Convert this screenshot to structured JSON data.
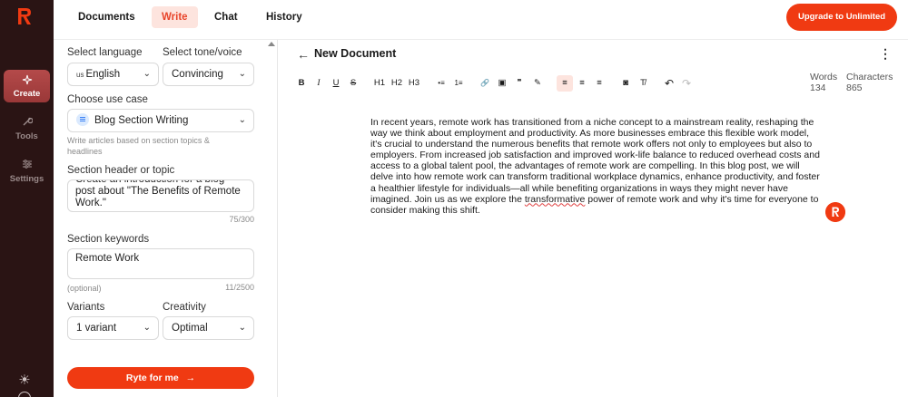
{
  "rail": {
    "items": [
      {
        "label": "Create",
        "icon": "sparkle-icon"
      },
      {
        "label": "Tools",
        "icon": "wrench-icon"
      },
      {
        "label": "Settings",
        "icon": "sliders-icon"
      }
    ],
    "theme_icon": "sun-icon",
    "bottom_icon": "help-icon"
  },
  "topnav": {
    "tabs": [
      "Documents",
      "Write",
      "Chat",
      "History"
    ],
    "active_tab": "Write",
    "upgrade_label": "Upgrade to Unlimited"
  },
  "form": {
    "language_label": "Select language",
    "language_flag": "us",
    "language_value": "English",
    "tone_label": "Select tone/voice",
    "tone_value": "Convincing",
    "usecase_label": "Choose use case",
    "usecase_value": "Blog Section Writing",
    "usecase_hint": "Write articles based on section topics & headlines",
    "topic_label": "Section header or topic",
    "topic_value": "Create an introduction for a blog post about \"The Benefits of Remote Work.\"",
    "topic_counter": "75/300",
    "keywords_label": "Section keywords",
    "keywords_value": "Remote Work",
    "keywords_optional": "(optional)",
    "keywords_counter": "11/2500",
    "variants_label": "Variants",
    "variants_value": "1 variant",
    "creativity_label": "Creativity",
    "creativity_value": "Optimal",
    "submit_label": "Ryte for me",
    "submit_arrow": "→"
  },
  "editor": {
    "back_icon": "←",
    "title": "New Document",
    "menu_icon": "⋮",
    "toolbar": {
      "bold": "B",
      "italic": "I",
      "underline": "U",
      "strike": "S",
      "h1": "H1",
      "h2": "H2",
      "h3": "H3",
      "bullet_list": "•≡",
      "ordered_list": "1≡",
      "link": "🔗",
      "image": "▣",
      "quote": "❞",
      "highlight": "✎",
      "align_left": "≡",
      "align_center": "≡",
      "align_right": "≡",
      "embed": "◙",
      "clear_format": "T̸",
      "undo": "↶",
      "redo": "↷"
    },
    "words_label": "Words",
    "words_value": "134",
    "chars_label": "Characters",
    "chars_value": "865",
    "body_before": "In recent years, remote work has transitioned from a niche concept to a mainstream reality, reshaping the way we think about employment and productivity. As more businesses embrace this flexible work model, it's crucial to understand the numerous benefits that remote work offers not only to employees but also to employers. From increased job satisfaction and improved work-life balance to reduced overhead costs and access to a global talent pool, the advantages of remote work are compelling. In this blog post, we will delve into how remote work can transform traditional workplace dynamics, enhance productivity, and foster a healthier lifestyle for individuals—all while benefiting organizations in ways they might never have imagined. Join us as we explore the ",
    "body_flagged": "transformative",
    "body_after": " power of remote work and why it's time for everyone to consider making this shift.",
    "brand_color": "#f03a12"
  }
}
